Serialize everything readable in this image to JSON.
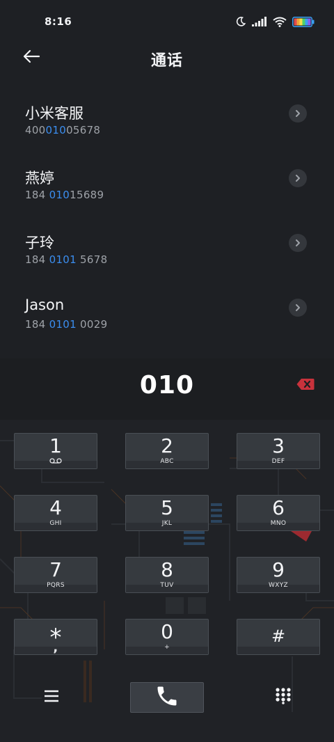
{
  "status": {
    "time": "8:16",
    "icons": [
      "moon-icon",
      "signal-icon",
      "wifi-icon",
      "battery-icon"
    ],
    "battery_colors": [
      "#e34b4b",
      "#f0a33b",
      "#f4e04a",
      "#4fd16a",
      "#3aa0f2",
      "#8a5cf0"
    ]
  },
  "header": {
    "back_icon": "arrow-left-icon",
    "title": "通话"
  },
  "contacts": [
    {
      "name": "小米客服",
      "number_pre": "400",
      "number_hl": "010",
      "number_post": "05678"
    },
    {
      "name": "燕婷",
      "number_pre": "184 ",
      "number_hl": "010",
      "number_post": "15689"
    },
    {
      "name": "子玲",
      "number_pre": "184 ",
      "number_hl": "0101",
      "number_post": " 5678"
    },
    {
      "name": "Jason",
      "number_pre": "184 ",
      "number_hl": "0101",
      "number_post": " 0029"
    }
  ],
  "dial": {
    "number": "010",
    "delete_icon": "backspace-icon",
    "accent": "#c8323c",
    "highlight_color": "#3b8ef0"
  },
  "keypad": {
    "keys": [
      {
        "digit": "1",
        "letters": "",
        "sub_icon": "voicemail-icon"
      },
      {
        "digit": "2",
        "letters": "ABC"
      },
      {
        "digit": "3",
        "letters": "DEF"
      },
      {
        "digit": "4",
        "letters": "GHI"
      },
      {
        "digit": "5",
        "letters": "JKL"
      },
      {
        "digit": "6",
        "letters": "MNO"
      },
      {
        "digit": "7",
        "letters": "PQRS"
      },
      {
        "digit": "8",
        "letters": "TUV"
      },
      {
        "digit": "9",
        "letters": "WXYZ"
      },
      {
        "digit": "*",
        "letters": ","
      },
      {
        "digit": "0",
        "letters": "+"
      },
      {
        "digit": "#",
        "letters": ""
      }
    ]
  },
  "bottom_bar": {
    "menu_icon": "menu-icon",
    "call_icon": "phone-icon",
    "dialpad_icon": "dialpad-icon"
  }
}
